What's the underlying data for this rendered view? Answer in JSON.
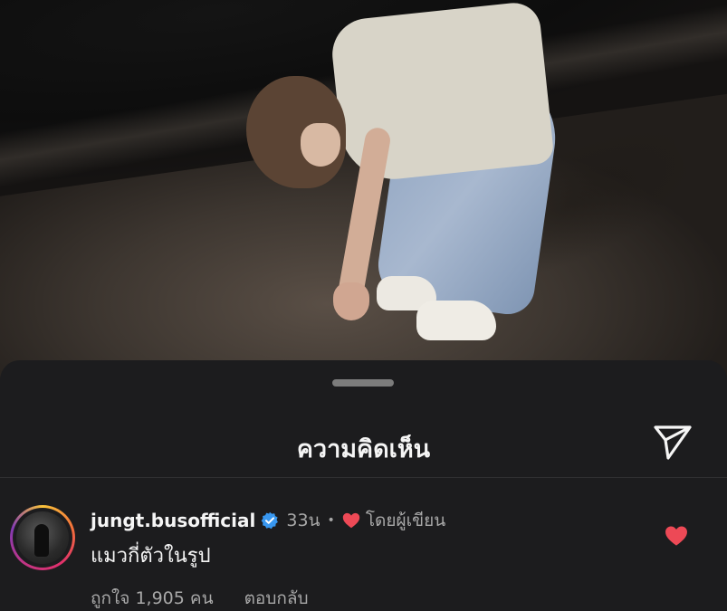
{
  "photo": {
    "description_icon": "photo-of-person-on-beach"
  },
  "sheet": {
    "title": "ความคิดเห็น",
    "share_icon": "send-icon"
  },
  "comment": {
    "username": "jungt.busofficial",
    "verified_icon": "verified-badge-icon",
    "time": "33น",
    "separator": "•",
    "author_like_icon": "heart-icon",
    "by_author": "โดยผู้เขียน",
    "text": "แมวกี่ตัวในรูป",
    "likes": "ถูกใจ 1,905 คน",
    "reply": "ตอบกลับ",
    "liked": true
  },
  "colors": {
    "background": "#1c1c1e",
    "text_primary": "#f5f5f5",
    "text_secondary": "#a8a8a8",
    "heart": "#ed4956",
    "verified": "#3897f0"
  }
}
